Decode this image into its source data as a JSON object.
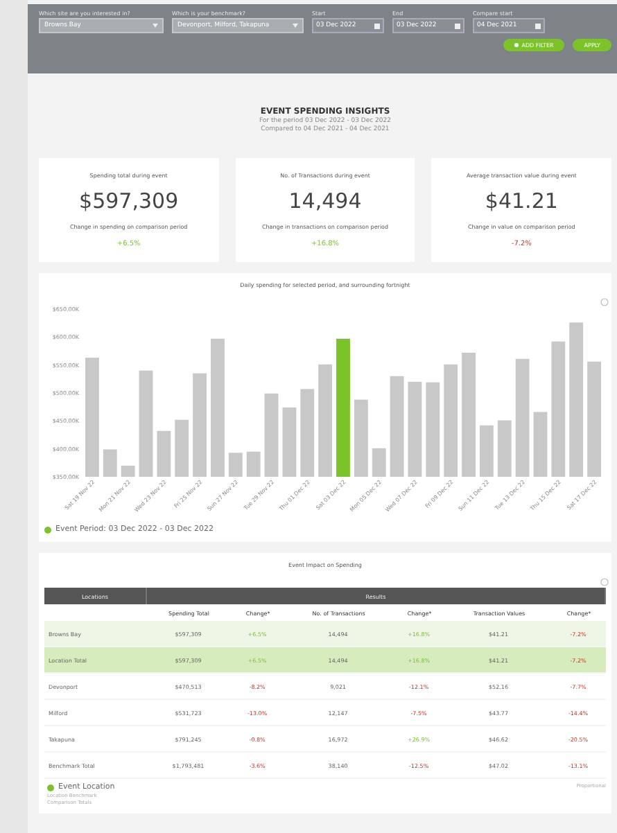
{
  "filters": {
    "site": {
      "label": "Which site are you interested in?",
      "value": "Browns Bay"
    },
    "benchmark": {
      "label": "Which is your benchmark?",
      "value": "Devonport, Milford, Takapuna"
    },
    "dates": [
      {
        "label": "Start",
        "value": "03 Dec 2022"
      },
      {
        "label": "End",
        "value": "03 Dec 2022"
      },
      {
        "label": "Compare start",
        "value": "04 Dec 2021"
      }
    ],
    "buttons": [
      {
        "label": "ADD FILTER",
        "kind": "icon"
      },
      {
        "label": "APPLY",
        "kind": "plain"
      }
    ]
  },
  "header": {
    "title": "EVENT SPENDING INSIGHTS",
    "period": "For the period 03 Dec 2022 - 03 Dec 2022",
    "compare": "Compared to 04 Dec 2021 - 04 Dec 2021"
  },
  "cards": [
    {
      "title": "Spending total during event",
      "value": "$597,309",
      "change_label": "Change in spending on comparison period",
      "change": "+6.5%"
    },
    {
      "title": "No. of Transactions during event",
      "value": "14,494",
      "change_label": "Change in transactions on comparison period",
      "change": "+16.8%"
    },
    {
      "title": "Average transaction value during event",
      "value": "$41.21",
      "change_label": "Change in value on comparison period",
      "change": "-7.2%"
    }
  ],
  "chart": {
    "legend": "Event Period: 03 Dec 2022 - 03 Dec 2022",
    "chart_data": {
      "type": "bar",
      "title": "Daily spending for selected period, and surrounding fortnight",
      "categories": [
        "Sat 19 Nov 22",
        null,
        "Mon 21 Nov 22",
        null,
        "Wed 23 Nov 22",
        null,
        "Fri 25 Nov 22",
        null,
        "Sun 27 Nov 22",
        null,
        "Tue 29 Nov 22",
        null,
        "Thu 01 Dec 22",
        null,
        "Sat 03 Dec 22",
        null,
        "Mon 05 Dec 22",
        null,
        "Wed 07 Dec 22",
        null,
        "Fri 09 Dec 22",
        null,
        "Sun 11 Dec 22",
        null,
        "Tue 13 Dec 22",
        null,
        "Thu 15 Dec 22",
        null,
        "Sat 17 Dec 22"
      ],
      "series": [
        {
          "color": "#c8c8c8",
          "values": [
            563,
            399,
            370,
            540,
            432,
            452,
            535,
            597,
            393,
            395,
            499,
            474,
            507,
            551,
            null,
            488,
            401,
            530,
            520,
            519,
            551,
            572,
            442,
            451,
            561,
            466,
            592,
            626,
            556
          ]
        },
        {
          "color": "#7cc32a",
          "values": [
            null,
            null,
            null,
            null,
            null,
            null,
            null,
            null,
            null,
            null,
            null,
            null,
            null,
            null,
            597,
            null,
            null,
            null,
            null,
            null,
            null,
            null,
            null,
            null,
            null,
            null,
            null,
            null,
            null
          ]
        }
      ],
      "ylim": [
        350,
        650
      ],
      "yticks": [
        {
          "value": 350,
          "label": "$350.00K"
        },
        {
          "value": 400,
          "label": "$400.00K"
        },
        {
          "value": 450,
          "label": "$450.00K"
        },
        {
          "value": 500,
          "label": "$500.00K"
        },
        {
          "value": 550,
          "label": "$550.00K"
        },
        {
          "value": 600,
          "label": "$600.00K"
        },
        {
          "value": 650,
          "label": "$650.00K"
        }
      ]
    }
  },
  "table": {
    "title": "Event Impact on Spending",
    "group_headers": [
      "Locations",
      "Results"
    ],
    "columns": [
      "",
      "Spending Total",
      "Change*",
      "No. of Transactions",
      "Change*",
      "Transaction Values",
      "Change*"
    ],
    "rows": [
      {
        "kind": "event",
        "cells": [
          "Browns Bay",
          "$597,309",
          "+6.5%",
          "14,494",
          "+16.8%",
          "$41.21",
          "-7.2%"
        ]
      },
      {
        "kind": "total",
        "cells": [
          "Location Total",
          "$597,309",
          "+6.5%",
          "14,494",
          "+16.8%",
          "$41.21",
          "-7.2%"
        ]
      },
      {
        "kind": "plain",
        "cells": [
          "Devonport",
          "$470,513",
          "-8.2%",
          "9,021",
          "-12.1%",
          "$52.16",
          "-7.7%"
        ]
      },
      {
        "kind": "plain",
        "cells": [
          "Milford",
          "$531,723",
          "-13.0%",
          "12,147",
          "-7.5%",
          "$43.77",
          "-14.4%"
        ]
      },
      {
        "kind": "plain",
        "cells": [
          "Takapuna",
          "$791,245",
          "-0.8%",
          "16,972",
          "+26.9%",
          "$46.62",
          "-20.5%"
        ]
      },
      {
        "kind": "plain",
        "cells": [
          "Benchmark Total",
          "$1,793,481",
          "-3.6%",
          "38,140",
          "-12.5%",
          "$47.02",
          "-13.1%"
        ]
      }
    ],
    "legend": "Event Location",
    "notes": [
      "Location Benchmark",
      "Comparison Totals"
    ],
    "side_note": "Proportional"
  }
}
